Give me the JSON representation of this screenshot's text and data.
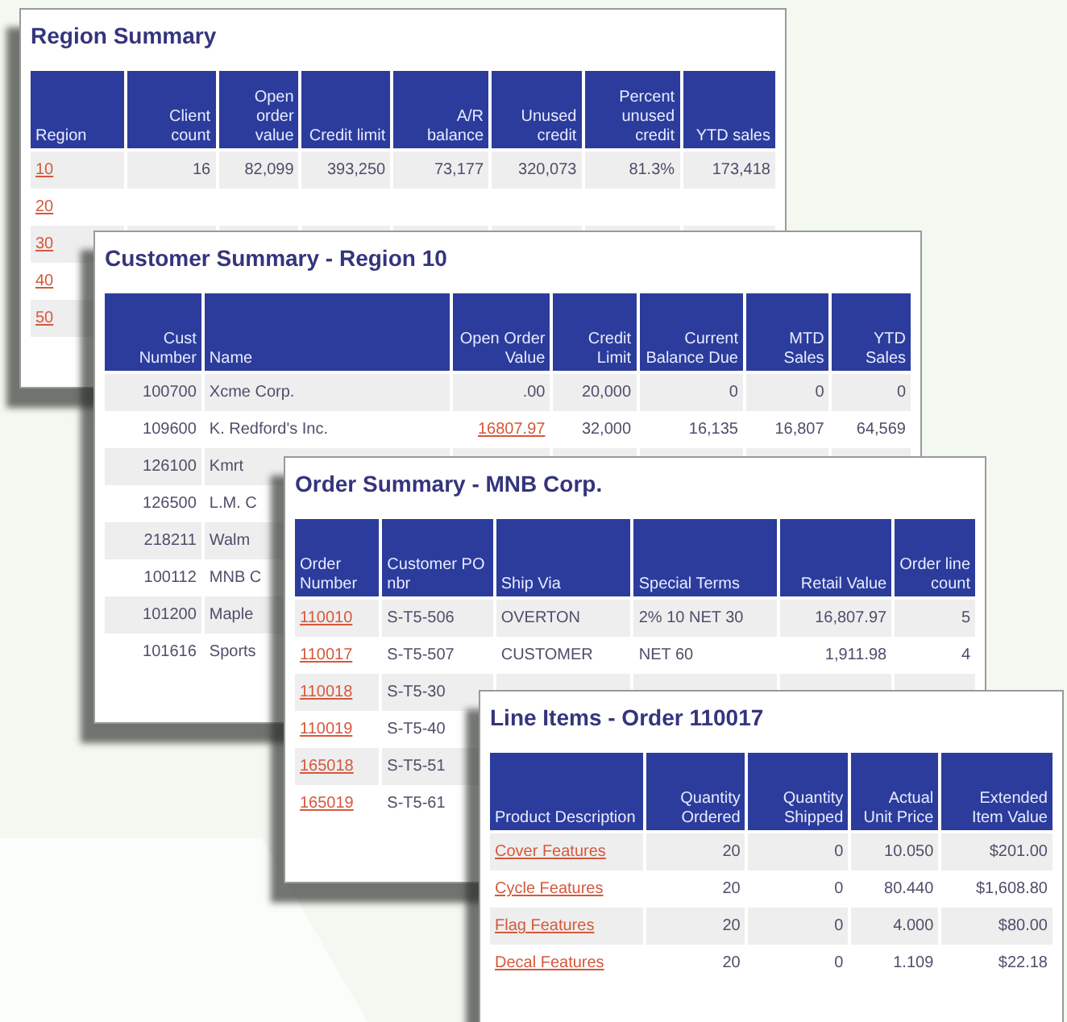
{
  "panels": [
    {
      "title": "Region Summary",
      "columns": [
        "Region",
        "Client count",
        "Open order value",
        "Credit limit",
        "A/R balance",
        "Unused credit",
        "Percent unused credit",
        "YTD sales"
      ],
      "rows": [
        [
          {
            "text": "10",
            "kind": "link"
          },
          "16",
          "82,099",
          "393,250",
          "73,177",
          "320,073",
          "81.3%",
          "173,418"
        ],
        [
          {
            "text": "20",
            "kind": "link"
          }
        ],
        [
          {
            "text": "30",
            "kind": "link"
          }
        ],
        [
          {
            "text": "40",
            "kind": "link"
          }
        ],
        [
          {
            "text": "50",
            "kind": "link"
          }
        ]
      ]
    },
    {
      "title": "Customer Summary - Region 10",
      "columns": [
        "Cust Number",
        "Name",
        "Open Order Value",
        "Credit Limit",
        "Current Balance Due",
        "MTD Sales",
        "YTD Sales"
      ],
      "rows": [
        [
          "100700",
          "Xcme Corp.",
          ".00",
          "20,000",
          "0",
          "0",
          "0"
        ],
        [
          "109600",
          "K. Redford's Inc.",
          {
            "text": "16807.97",
            "kind": "link"
          },
          "32,000",
          "16,135",
          "16,807",
          "64,569"
        ],
        [
          "126100",
          "Kmrt"
        ],
        [
          "126500",
          "L.M. C"
        ],
        [
          "218211",
          "Walm"
        ],
        [
          "100112",
          "MNB C"
        ],
        [
          "101200",
          "Maple"
        ],
        [
          "101616",
          "Sports"
        ]
      ]
    },
    {
      "title": "Order Summary - MNB Corp.",
      "columns": [
        "Order Number",
        "Customer PO nbr",
        "Ship Via",
        "Special Terms",
        "Retail Value",
        "Order line count"
      ],
      "rows": [
        [
          {
            "text": "110010",
            "kind": "link"
          },
          "S-T5-506",
          "OVERTON",
          "2% 10 NET 30",
          "16,807.97",
          "5"
        ],
        [
          {
            "text": "110017",
            "kind": "link"
          },
          "S-T5-507",
          "CUSTOMER",
          "NET 60",
          "1,911.98",
          "4"
        ],
        [
          {
            "text": "110018",
            "kind": "link"
          },
          "S-T5-30"
        ],
        [
          {
            "text": "110019",
            "kind": "link"
          },
          "S-T5-40"
        ],
        [
          {
            "text": "165018",
            "kind": "link"
          },
          "S-T5-51"
        ],
        [
          {
            "text": "165019",
            "kind": "link"
          },
          "S-T5-61"
        ]
      ]
    },
    {
      "title": "Line Items - Order 110017",
      "columns": [
        "Product Description",
        "Quantity Ordered",
        "Quantity Shipped",
        "Actual Unit Price",
        "Extended Item Value"
      ],
      "rows": [
        [
          {
            "text": "Cover Features",
            "kind": "link"
          },
          "20",
          "0",
          "10.050",
          "$201.00"
        ],
        [
          {
            "text": "Cycle Features",
            "kind": "link"
          },
          "20",
          "0",
          "80.440",
          "$1,608.80"
        ],
        [
          {
            "text": "Flag Features",
            "kind": "link"
          },
          "20",
          "0",
          "4.000",
          "$80.00"
        ],
        [
          {
            "text": "Decal Features",
            "kind": "link"
          },
          "20",
          "0",
          "1.109",
          "$22.18"
        ]
      ]
    }
  ]
}
